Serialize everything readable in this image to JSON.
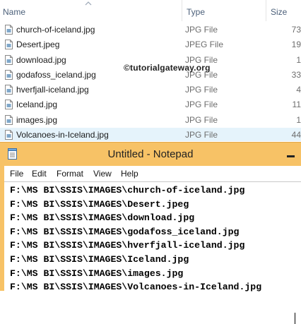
{
  "explorer": {
    "columns": {
      "name": "Name",
      "type": "Type",
      "size": "Size"
    },
    "files": [
      {
        "name": "church-of-iceland.jpg",
        "type": "JPG File",
        "size": "73",
        "selected": false
      },
      {
        "name": "Desert.jpeg",
        "type": "JPEG File",
        "size": "19",
        "selected": false
      },
      {
        "name": "download.jpg",
        "type": "JPG File",
        "size": "1",
        "selected": false
      },
      {
        "name": "godafoss_iceland.jpg",
        "type": "JPG File",
        "size": "33",
        "selected": false
      },
      {
        "name": "hverfjall-iceland.jpg",
        "type": "JPG File",
        "size": "4",
        "selected": false
      },
      {
        "name": "Iceland.jpg",
        "type": "JPG File",
        "size": "11",
        "selected": false
      },
      {
        "name": "images.jpg",
        "type": "JPG File",
        "size": "1",
        "selected": false
      },
      {
        "name": "Volcanoes-in-Iceland.jpg",
        "type": "JPG File",
        "size": "44",
        "selected": true
      }
    ],
    "watermark": "©tutorialgateway.org"
  },
  "notepad": {
    "title": "Untitled - Notepad",
    "menu": [
      "File",
      "Edit",
      "Format",
      "View",
      "Help"
    ],
    "lines": [
      "F:\\MS BI\\SSIS\\IMAGES\\church-of-iceland.jpg",
      "F:\\MS BI\\SSIS\\IMAGES\\Desert.jpeg",
      "F:\\MS BI\\SSIS\\IMAGES\\download.jpg",
      "F:\\MS BI\\SSIS\\IMAGES\\godafoss_iceland.jpg",
      "F:\\MS BI\\SSIS\\IMAGES\\hverfjall-iceland.jpg",
      "F:\\MS BI\\SSIS\\IMAGES\\Iceland.jpg",
      "F:\\MS BI\\SSIS\\IMAGES\\images.jpg",
      "F:\\MS BI\\SSIS\\IMAGES\\Volcanoes-in-Iceland.jpg"
    ]
  },
  "colors": {
    "titlebar": "#f7c266",
    "selected_row": "#e5f3fb",
    "header_text": "#4c607a",
    "secondary_text": "#6d6d6d"
  },
  "icons": {
    "file": "file-icon",
    "sort": "sort-up-arrow-icon",
    "notepad": "notepad-app-icon",
    "minimize": "minimize-icon"
  }
}
